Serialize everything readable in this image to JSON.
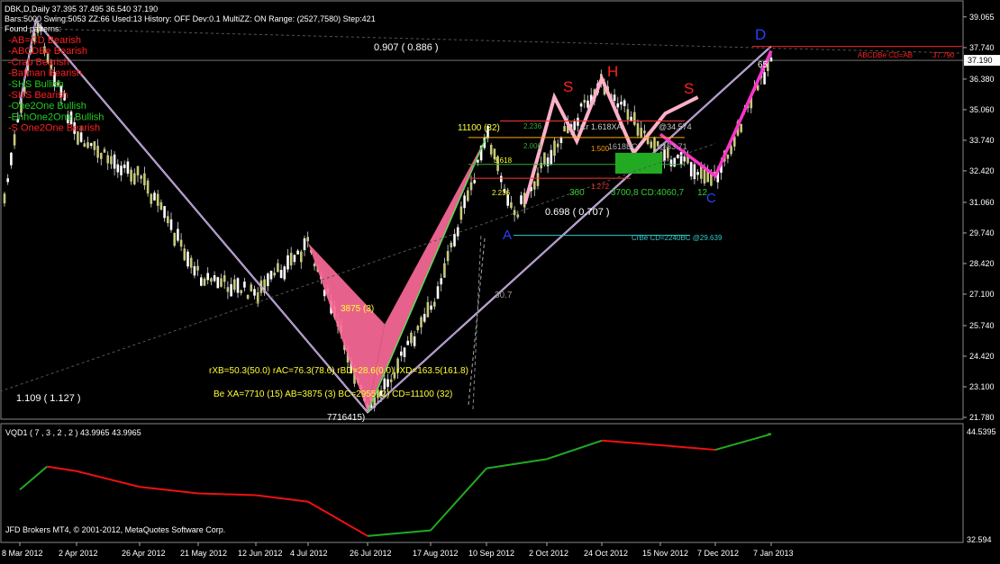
{
  "header": {
    "title": "DBK,D,Daily  37.395 37.495 36.540 37.190",
    "info": "Bars:5000  Swing:5053  ZZ:66  Used:13  History: OFF Dev:0.1  MultiZZ: ON  Range: (2527,7580)  Step:421",
    "found_label": "Found patterns:"
  },
  "patterns": [
    {
      "text": "-AB=CD Bearish",
      "color": "#ff2020"
    },
    {
      "text": "-ABCDBe Bearish",
      "color": "#ff2020"
    },
    {
      "text": "-Crab Bearish",
      "color": "#ff2020"
    },
    {
      "text": "-Batman Bearish",
      "color": "#ff2020"
    },
    {
      "text": "-SHS Bullish",
      "color": "#22cc22"
    },
    {
      "text": "-SHS Bearish",
      "color": "#ff2020"
    },
    {
      "text": "-One2One Bullish",
      "color": "#22cc22"
    },
    {
      "text": "-EnhOne2One Bullish",
      "color": "#22cc22"
    },
    {
      "text": "-S One2One Bearish",
      "color": "#ff2020"
    }
  ],
  "price_axis": {
    "ticks": [
      "39.065",
      "37.740",
      "36.380",
      "35.060",
      "33.740",
      "32.420",
      "31.060",
      "29.740",
      "28.420",
      "27.100",
      "25.740",
      "24.420",
      "23.100",
      "21.780"
    ],
    "current_price": "37.190",
    "abcdbe_price": "37.790"
  },
  "date_axis": [
    "8 Mar 2012",
    "2 Apr 2012",
    "26 Apr 2012",
    "21 May 2012",
    "12 Jun 2012",
    "4 Jul 2012",
    "26 Jul 2012",
    "17 Aug 2012",
    "10 Sep 2012",
    "2 Oct 2012",
    "24 Oct 2012",
    "15 Nov 2012",
    "7 Dec 2012",
    "7 Jan 2013"
  ],
  "labels": {
    "ratio_top": "0.907 ( 0.886 )",
    "ratio_left": "1.109 ( 1.127 )",
    "ratio_mid": "0.698 ( 0.707 )",
    "lbl_11100": "11100 (32)",
    "lbl_3875": "3875 (3)",
    "lbl_7716": "7716415)",
    "lbl_D": "D",
    "lbl_A": "A",
    "lbl_C": "C",
    "lbl_H": "H",
    "lbl_S1": "S",
    "lbl_S2": "S",
    "fib_2236": "2.236",
    "fib_2000": "2.000",
    "fib_1500": "1.500",
    "fib_1272": "1.272",
    "fib_3618": "3.618",
    "fib_2_236b": "2.236",
    "crab_label": "Cr 1.618XA",
    "crab_price": "@34.574",
    "bc_label": "1618BC",
    "bc_price": "@33.71",
    "cd_label": "3700,8 CD:4060,7",
    "crbe": "CrBe CD=2240BC   @29.639",
    "abcdbe": "ABCDBe CD=AB",
    "n360": "360",
    "n12": "12",
    "n65": "65",
    "n30_7": "30.7",
    "rxb": "rXB=50.3(50.0)  rAC=76.3(78.6)  rBD=28.6(0.0)  rXD=163.5(161.8)",
    "be": "Be  XA=7710 (15)  AB=3875 (3)  BC=2955 (2)  CD=11100 (32)"
  },
  "indicator": {
    "title": "VQD1  ( 7 , 3 , 2 , 2 )  43.9965 43.9965",
    "axis_top": "44.5395",
    "axis_bottom": "32.594"
  },
  "footer": "JFD Brokers MT4, © 2001-2012, MetaQuotes Software Corp.",
  "chart_data": {
    "type": "candlestick",
    "instrument": "DBK",
    "timeframe": "Daily",
    "ylim": [
      21.78,
      39.6
    ],
    "x_range": [
      "8 Mar 2012",
      "7 Jan 2013"
    ],
    "price_path": [
      {
        "date": "8 Mar 2012",
        "price": 35.1
      },
      {
        "date": "15 Mar 2012",
        "price": 38.9
      },
      {
        "date": "2 Apr 2012",
        "price": 33.7
      },
      {
        "date": "26 Apr 2012",
        "price": 32.2
      },
      {
        "date": "21 May 2012",
        "price": 27.9
      },
      {
        "date": "12 Jun 2012",
        "price": 27.1
      },
      {
        "date": "4 Jul 2012",
        "price": 29.3
      },
      {
        "date": "26 Jul 2012",
        "price": 22.0
      },
      {
        "date": "17 Aug 2012",
        "price": 26.5
      },
      {
        "date": "10 Sep 2012",
        "price": 33.9
      },
      {
        "date": "20 Sep 2012",
        "price": 30.5
      },
      {
        "date": "2 Oct 2012",
        "price": 33.0
      },
      {
        "date": "24 Oct 2012",
        "price": 36.3
      },
      {
        "date": "15 Nov 2012",
        "price": 33.2
      },
      {
        "date": "7 Dec 2012",
        "price": 32.1
      },
      {
        "date": "7 Jan 2013",
        "price": 37.4
      }
    ],
    "pattern_points": {
      "X": 38.9,
      "A": 22.0,
      "B": 33.9,
      "C": 30.5,
      "D": 37.79
    },
    "horizontal_levels": [
      {
        "label": "ABCDBe CD=AB",
        "price": 37.79
      },
      {
        "label": "CrBe CD=2240BC",
        "price": 29.639
      },
      {
        "label": "Cr 1.618XA",
        "price": 34.574
      }
    ],
    "indicator_series": {
      "name": "VQD1",
      "ylim": [
        32.594,
        44.5395
      ],
      "points": [
        {
          "date": "8 Mar 2012",
          "value": 38.0
        },
        {
          "date": "20 Mar 2012",
          "value": 40.5
        },
        {
          "date": "2 Apr 2012",
          "value": 40.0
        },
        {
          "date": "26 Apr 2012",
          "value": 38.3
        },
        {
          "date": "21 May 2012",
          "value": 37.6
        },
        {
          "date": "12 Jun 2012",
          "value": 37.4
        },
        {
          "date": "4 Jul 2012",
          "value": 36.7
        },
        {
          "date": "26 Jul 2012",
          "value": 33.0
        },
        {
          "date": "17 Aug 2012",
          "value": 33.6
        },
        {
          "date": "10 Sep 2012",
          "value": 40.3
        },
        {
          "date": "2 Oct 2012",
          "value": 41.3
        },
        {
          "date": "24 Oct 2012",
          "value": 43.3
        },
        {
          "date": "15 Nov 2012",
          "value": 42.8
        },
        {
          "date": "7 Dec 2012",
          "value": 42.3
        },
        {
          "date": "7 Jan 2013",
          "value": 44.0
        }
      ]
    }
  }
}
